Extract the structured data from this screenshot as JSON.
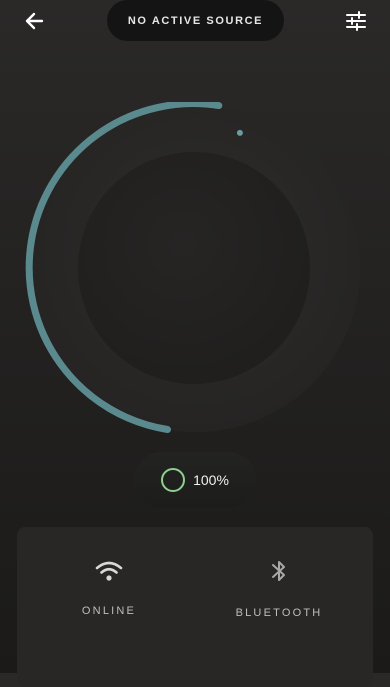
{
  "header": {
    "back_icon": "arrow-left-icon",
    "source_label": "NO ACTIVE SOURCE",
    "settings_icon": "sliders-icon"
  },
  "dial": {
    "level": 0.62,
    "arc_color": "#5b8a8e",
    "indicator_color": "#6a9ca2"
  },
  "volume": {
    "value": "100%",
    "ring_color": "#8fd08f"
  },
  "status": {
    "online": {
      "label": "ONLINE",
      "icon": "wifi-icon"
    },
    "bluetooth": {
      "label": "BLUETOOTH",
      "icon": "bluetooth-icon"
    }
  }
}
